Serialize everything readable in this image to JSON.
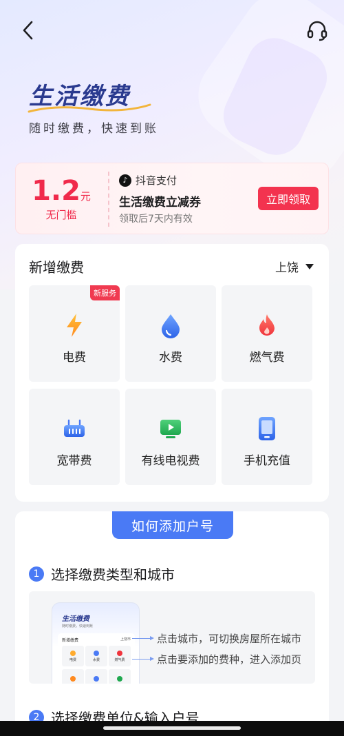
{
  "header": {
    "title": "生活缴费",
    "subtitle": "随时缴费，快速到账",
    "back_icon": "back-arrow-icon",
    "support_icon": "headset-icon"
  },
  "coupon": {
    "amount": "1.2",
    "unit": "元",
    "condition": "无门槛",
    "brand": "抖音支付",
    "name": "生活缴费立减券",
    "validity": "领取后7天内有效",
    "claim_label": "立即领取",
    "accent_color": "#f3334f"
  },
  "new_payment": {
    "title": "新增缴费",
    "city": "上饶",
    "badge": "新服务",
    "services": [
      {
        "label": "电费",
        "icon": "lightning-icon"
      },
      {
        "label": "水费",
        "icon": "water-drop-icon"
      },
      {
        "label": "燃气费",
        "icon": "flame-icon"
      },
      {
        "label": "宽带费",
        "icon": "router-icon"
      },
      {
        "label": "有线电视费",
        "icon": "tv-icon"
      },
      {
        "label": "手机充值",
        "icon": "phone-icon"
      }
    ]
  },
  "howto": {
    "tab": "如何添加户号",
    "steps": [
      {
        "num": "1",
        "text": "选择缴费类型和城市"
      },
      {
        "num": "2",
        "text": "选择缴费单位&输入户号"
      }
    ],
    "mini_preview": {
      "title": "生活缴费",
      "subtitle": "随时缴费，快速到账",
      "card_title": "新增缴费",
      "city": "上饶市",
      "tiles": [
        "电费",
        "水费",
        "燃气费"
      ]
    },
    "callouts": [
      "点击城市，可切换房屋所在城市",
      "点击要添加的费种，进入添加页"
    ]
  }
}
